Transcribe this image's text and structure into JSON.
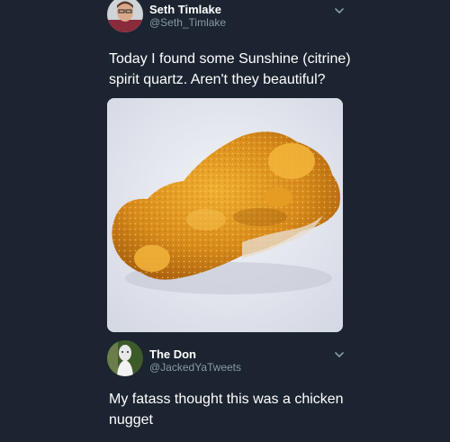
{
  "tweets": [
    {
      "display_name": "Seth Timlake",
      "handle": "@Seth_Timlake",
      "text": "Today I found some Sunshine (citrine) spirit quartz. Aren't they beautiful?",
      "avatar_icon": "user-avatar-photo",
      "menu_icon": "chevron-down-icon"
    },
    {
      "display_name": "The Don",
      "handle": "@JackedYaTweets",
      "text": "My fatass thought this was a chicken nugget",
      "avatar_icon": "user-avatar-photo",
      "menu_icon": "chevron-down-icon"
    }
  ],
  "colors": {
    "background": "#1b2430",
    "text_primary": "#ffffff",
    "text_secondary": "#8899a6",
    "crystal": "#d98a1a"
  }
}
